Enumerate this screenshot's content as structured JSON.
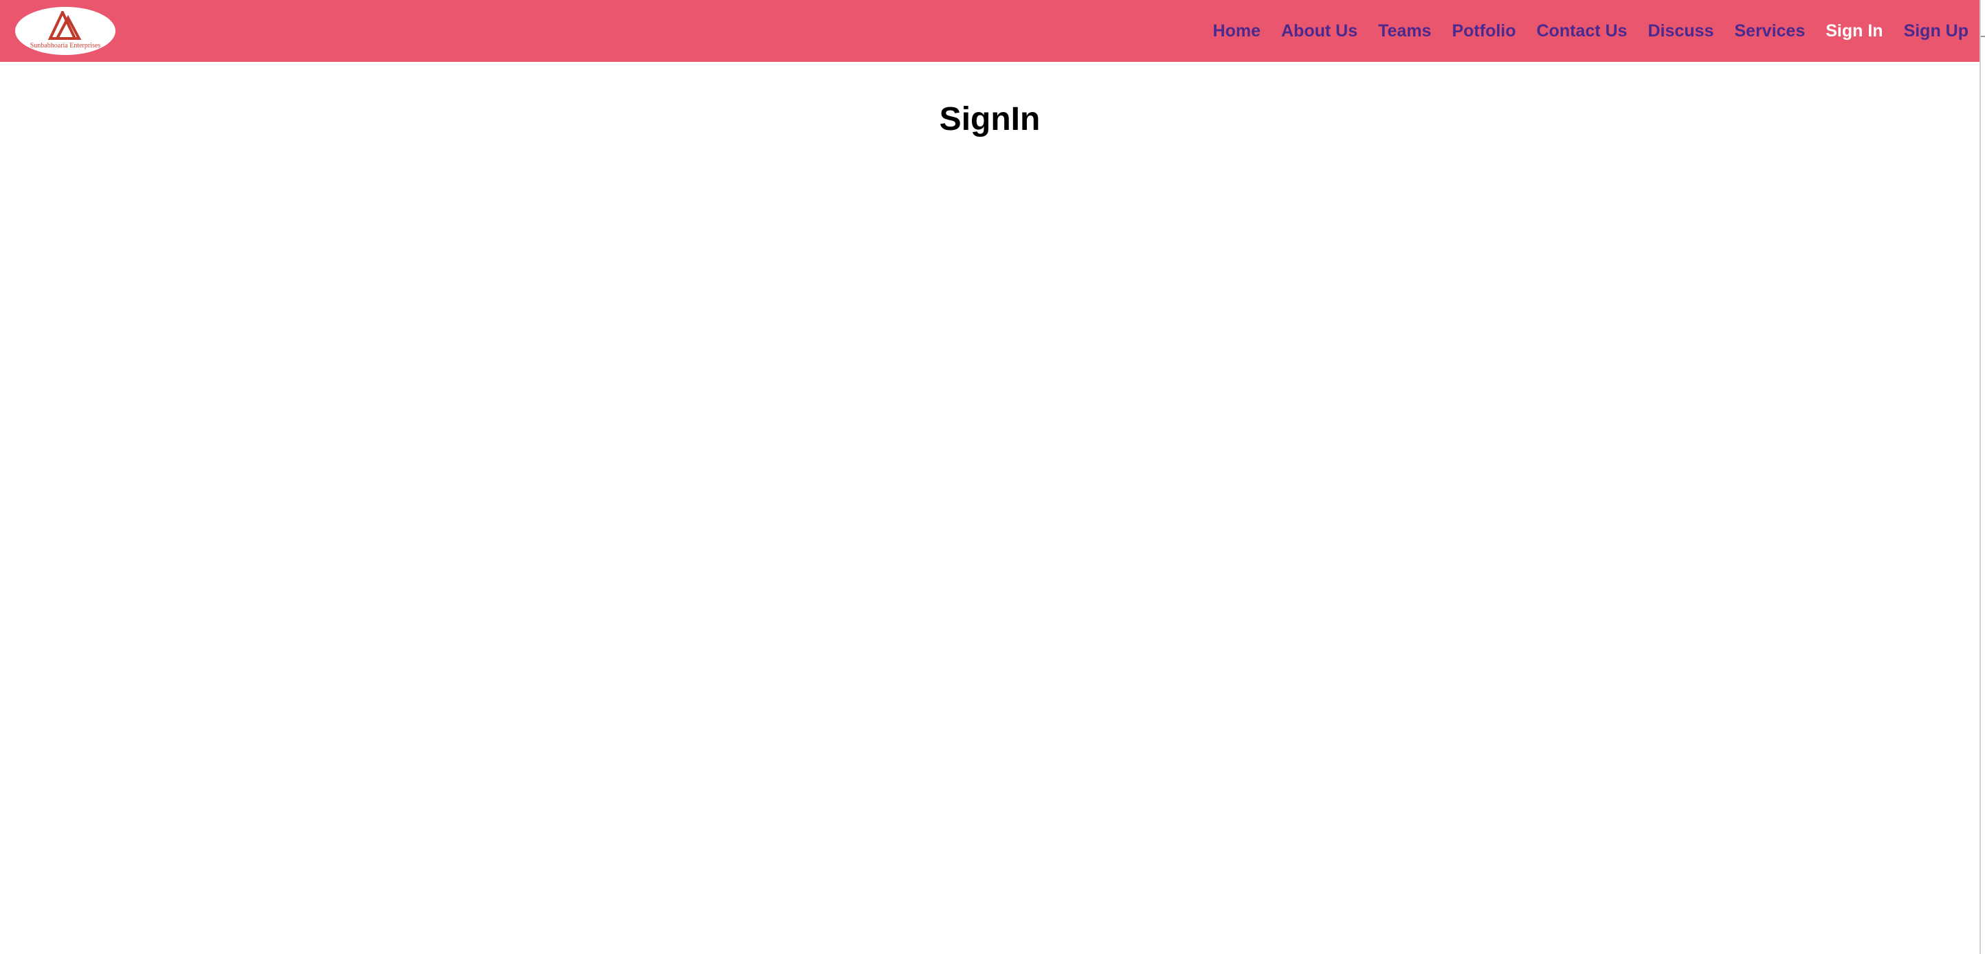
{
  "colors": {
    "navbar_background": "#e9566e",
    "nav_link": "#4b2a8f",
    "nav_link_active": "#ffffff",
    "logo_mark": "#c0392b",
    "logo_text": "#d0453a",
    "page_background": "#ffffff",
    "title": "#000000"
  },
  "navbar": {
    "logo": {
      "icon": "triangle-logo-icon",
      "text": "Sunbabhoaria Enterprises"
    },
    "links": [
      {
        "label": "Home",
        "active": false
      },
      {
        "label": "About Us",
        "active": false
      },
      {
        "label": "Teams",
        "active": false
      },
      {
        "label": "Potfolio",
        "active": false
      },
      {
        "label": "Contact Us",
        "active": false
      },
      {
        "label": "Discuss",
        "active": false
      },
      {
        "label": "Services",
        "active": false
      },
      {
        "label": "Sign In",
        "active": true
      },
      {
        "label": "Sign Up",
        "active": false
      }
    ]
  },
  "main": {
    "title": "SignIn"
  }
}
